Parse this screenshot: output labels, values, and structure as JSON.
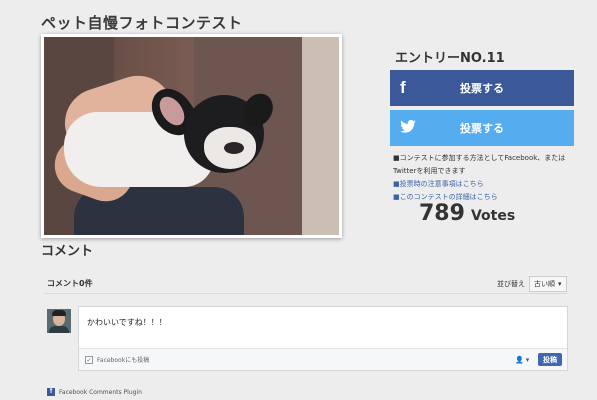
{
  "page": {
    "title": "ペット自慢フォトコンテスト"
  },
  "photo": {
    "alt": ""
  },
  "entry": {
    "title": "エントリーNO.11",
    "facebook_vote_label": "投票する",
    "twitter_vote_label": "投票する",
    "info_line1": "■コンテストに参加する方法としてFacebook、またはTwitterを利用できます",
    "info_link1": "■投票時の注意事項はこちら",
    "info_link2": "■このコンテストの詳細はこちら",
    "votes_count": "789",
    "votes_unit": "Votes"
  },
  "comments": {
    "heading": "コメント",
    "count_label": "コメント0件",
    "sort_label": "並び替え",
    "sort_value": "古い順",
    "input_value": "かわいいですね！！！",
    "post_to_facebook_label": "Facebookにも投稿",
    "post_button": "投稿",
    "plugin_label": "Facebook Comments Plugin"
  },
  "colors": {
    "facebook": "#3b5998",
    "twitter": "#55acee",
    "link": "#3b62a8"
  }
}
